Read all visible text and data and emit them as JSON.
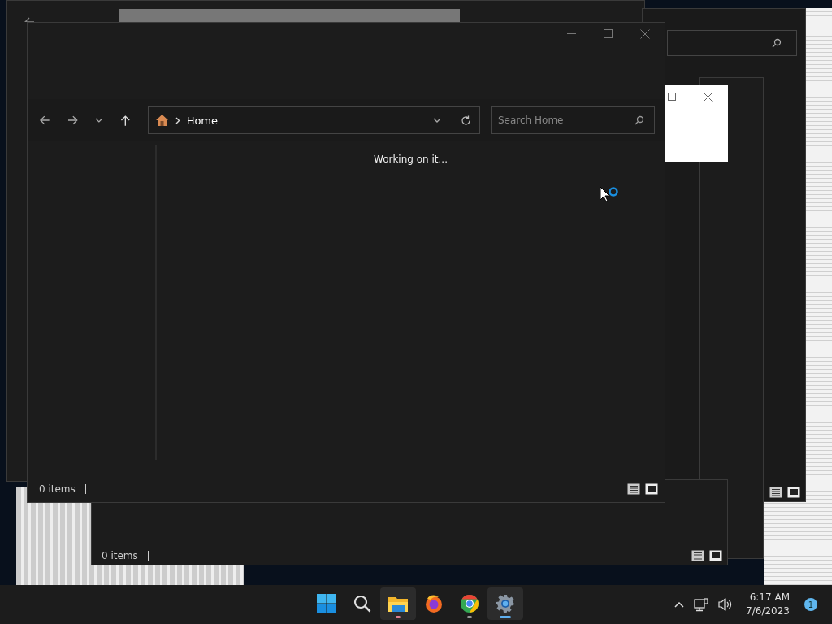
{
  "main_window": {
    "address": "Home",
    "search": {
      "placeholder": "Search Home"
    },
    "message": "Working on it...",
    "status": "0 items"
  },
  "background_window": {
    "status": "0 items"
  },
  "taskbar": {
    "apps": [
      {
        "kind": "start",
        "running": false,
        "active": false
      },
      {
        "kind": "search",
        "running": false,
        "active": false
      },
      {
        "kind": "folder",
        "running": true,
        "active": true
      },
      {
        "kind": "browser-fox",
        "running": false,
        "active": false
      },
      {
        "kind": "browser-ring",
        "running": true,
        "active": false
      },
      {
        "kind": "gear",
        "running": true,
        "active": true
      }
    ],
    "time": "6:17 AM",
    "date": "7/6/2023",
    "notification_count": "1"
  }
}
